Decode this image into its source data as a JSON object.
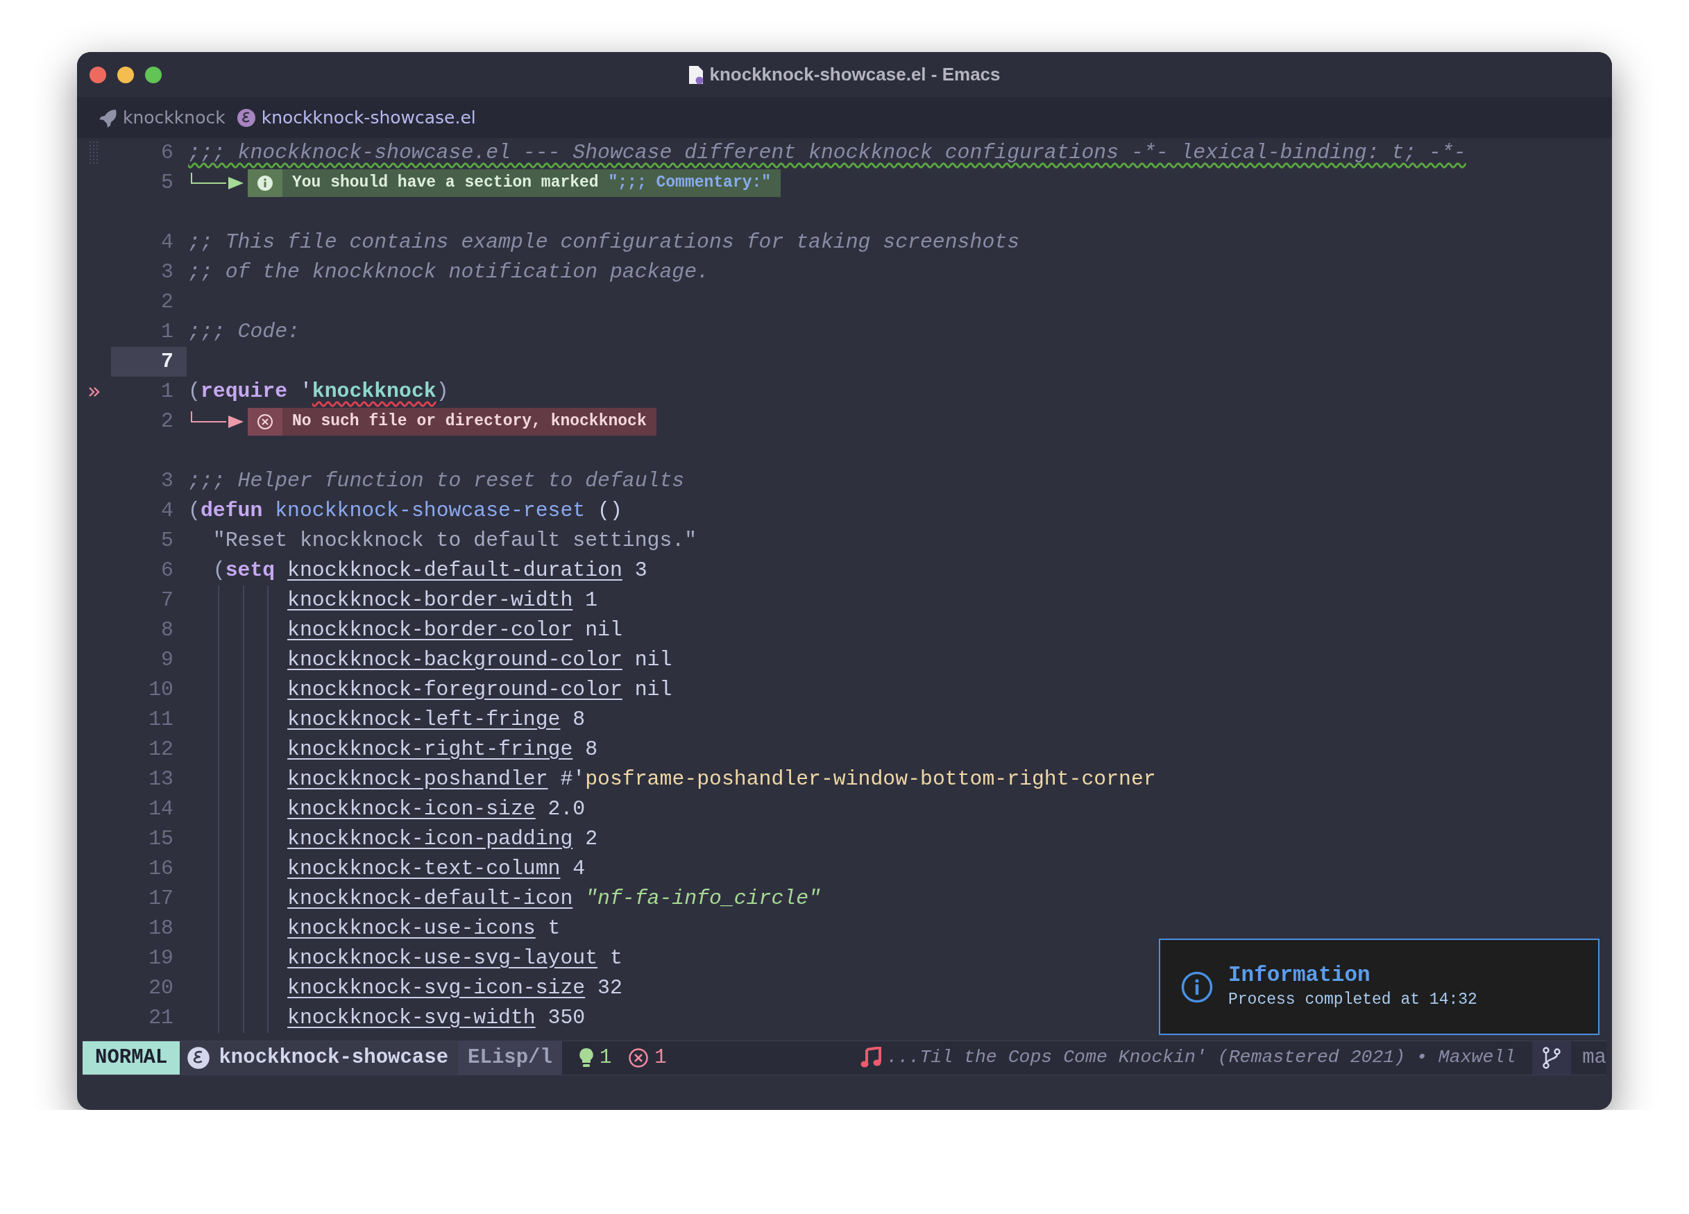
{
  "window": {
    "title": "knockknock-showcase.el - Emacs"
  },
  "tab_bar": {
    "project": "knockknock",
    "file": "knockknock-showcase.el"
  },
  "lines": [
    {
      "kind": "code",
      "number": "6",
      "fringe_dots": true,
      "segments": [
        {
          "text": ";;; knockknock-showcase.el --- Showcase different knockknock configurations -*- lexical-binding: t; -*-",
          "kind": "comment",
          "warning_underline": true
        }
      ]
    },
    {
      "kind": "info",
      "number": "5",
      "segments": [
        {
          "text": "You should have a section marked ",
          "kind": "plain"
        },
        {
          "text": "\";;; Commentary:\"",
          "kind": "highlight"
        }
      ]
    },
    {
      "kind": "blank"
    },
    {
      "kind": "code",
      "number": "4",
      "segments": [
        {
          "text": ";; This file contains example configurations for taking screenshots",
          "kind": "comment"
        }
      ]
    },
    {
      "kind": "code",
      "number": "3",
      "segments": [
        {
          "text": ";; of the knockknock notification package.",
          "kind": "comment"
        }
      ]
    },
    {
      "kind": "code",
      "number": "2"
    },
    {
      "kind": "code",
      "number": "1",
      "segments": [
        {
          "text": ";;; Code:",
          "kind": "comment"
        }
      ]
    },
    {
      "kind": "code",
      "number": "7",
      "current": true
    },
    {
      "kind": "code",
      "number": "1",
      "fringe_chevron": true,
      "segments": [
        {
          "text": "(",
          "kind": "paren"
        },
        {
          "text": "require",
          "kind": "keyword"
        },
        {
          "text": " '",
          "kind": "plain"
        },
        {
          "text": "knockknock",
          "kind": "quoted",
          "error_underline": true
        },
        {
          "text": ")",
          "kind": "paren"
        }
      ]
    },
    {
      "kind": "error",
      "number": "2",
      "segments": [
        {
          "text": "No such file or directory, knockknock",
          "kind": "plain"
        }
      ]
    },
    {
      "kind": "blank"
    },
    {
      "kind": "code",
      "number": "3",
      "segments": [
        {
          "text": ";;; Helper function to reset to defaults",
          "kind": "comment"
        }
      ]
    },
    {
      "kind": "code",
      "number": "4",
      "segments": [
        {
          "text": "(",
          "kind": "paren"
        },
        {
          "text": "defun ",
          "kind": "keyword"
        },
        {
          "text": "knockknock-showcase-reset",
          "kind": "function"
        },
        {
          "text": " ()",
          "kind": "plain"
        }
      ]
    },
    {
      "kind": "code",
      "number": "5",
      "segments": [
        {
          "text": "  \"Reset knockknock to default settings.\"",
          "kind": "doc"
        }
      ]
    },
    {
      "kind": "code",
      "number": "6",
      "segments": [
        {
          "text": "  (",
          "kind": "paren"
        },
        {
          "text": "setq ",
          "kind": "keyword"
        },
        {
          "text": "knockknock-default-duration",
          "kind": "variable"
        },
        {
          "text": " 3",
          "kind": "plain"
        }
      ]
    },
    {
      "kind": "code",
      "number": "7",
      "guides": true,
      "segments": [
        {
          "text": "knockknock-border-width",
          "kind": "variable"
        },
        {
          "text": " 1",
          "kind": "plain"
        }
      ]
    },
    {
      "kind": "code",
      "number": "8",
      "guides": true,
      "segments": [
        {
          "text": "knockknock-border-color",
          "kind": "variable"
        },
        {
          "text": " nil",
          "kind": "plain"
        }
      ]
    },
    {
      "kind": "code",
      "number": "9",
      "guides": true,
      "segments": [
        {
          "text": "knockknock-background-color",
          "kind": "variable"
        },
        {
          "text": " nil",
          "kind": "plain"
        }
      ]
    },
    {
      "kind": "code",
      "number": "10",
      "guides": true,
      "segments": [
        {
          "text": "knockknock-foreground-color",
          "kind": "variable"
        },
        {
          "text": " nil",
          "kind": "plain"
        }
      ]
    },
    {
      "kind": "code",
      "number": "11",
      "guides": true,
      "segments": [
        {
          "text": "knockknock-left-fringe",
          "kind": "variable"
        },
        {
          "text": " 8",
          "kind": "plain"
        }
      ]
    },
    {
      "kind": "code",
      "number": "12",
      "guides": true,
      "segments": [
        {
          "text": "knockknock-right-fringe",
          "kind": "variable"
        },
        {
          "text": " 8",
          "kind": "plain"
        }
      ]
    },
    {
      "kind": "code",
      "number": "13",
      "guides": true,
      "segments": [
        {
          "text": "knockknock-poshandler",
          "kind": "variable"
        },
        {
          "text": " #'",
          "kind": "plain"
        },
        {
          "text": "posframe-poshandler-window-bottom-right-corner",
          "kind": "symbol"
        }
      ]
    },
    {
      "kind": "code",
      "number": "14",
      "guides": true,
      "segments": [
        {
          "text": "knockknock-icon-size",
          "kind": "variable"
        },
        {
          "text": " 2.0",
          "kind": "plain"
        }
      ]
    },
    {
      "kind": "code",
      "number": "15",
      "guides": true,
      "segments": [
        {
          "text": "knockknock-icon-padding",
          "kind": "variable"
        },
        {
          "text": " 2",
          "kind": "plain"
        }
      ]
    },
    {
      "kind": "code",
      "number": "16",
      "guides": true,
      "segments": [
        {
          "text": "knockknock-text-column",
          "kind": "variable"
        },
        {
          "text": " 4",
          "kind": "plain"
        }
      ]
    },
    {
      "kind": "code",
      "number": "17",
      "guides": true,
      "segments": [
        {
          "text": "knockknock-default-icon",
          "kind": "variable"
        },
        {
          "text": " \"nf-fa-info_circle\"",
          "kind": "string"
        }
      ]
    },
    {
      "kind": "code",
      "number": "18",
      "guides": true,
      "segments": [
        {
          "text": "knockknock-use-icons",
          "kind": "variable"
        },
        {
          "text": " t",
          "kind": "plain"
        }
      ]
    },
    {
      "kind": "code",
      "number": "19",
      "guides": true,
      "segments": [
        {
          "text": "knockknock-use-svg-layout",
          "kind": "variable"
        },
        {
          "text": " t",
          "kind": "plain"
        }
      ]
    },
    {
      "kind": "code",
      "number": "20",
      "guides": true,
      "segments": [
        {
          "text": "knockknock-svg-icon-size",
          "kind": "variable"
        },
        {
          "text": " 32",
          "kind": "plain"
        }
      ]
    },
    {
      "kind": "code",
      "number": "21",
      "guides": true,
      "segments": [
        {
          "text": "knockknock-svg-width",
          "kind": "variable"
        },
        {
          "text": " 350",
          "kind": "plain"
        }
      ]
    }
  ],
  "notification": {
    "title": "Information",
    "message": "Process completed at 14:32"
  },
  "mode_line": {
    "state": "NORMAL",
    "buffer": "knockknock-showcase",
    "major_mode": "ELisp/l",
    "warnings": "1",
    "errors": "1",
    "music": "...Til the Cops Come Knockin' (Remastered 2021) • Maxwell",
    "branch": "ma"
  }
}
